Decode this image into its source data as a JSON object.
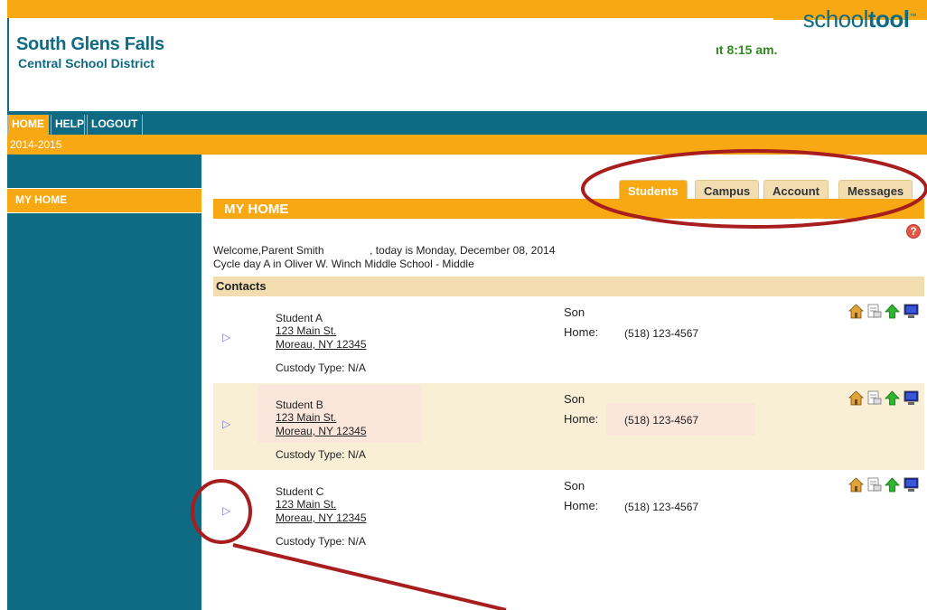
{
  "header": {
    "district_line1": "South Glens Falls",
    "district_line2": "Central School District",
    "clock_text": "ıt 8:15 am.",
    "logo_plain": "school",
    "logo_bold": "tool",
    "logo_tm": "™"
  },
  "nav": {
    "items": [
      "HOME",
      "HELP",
      "LOGOUT"
    ]
  },
  "year": "2014-2015",
  "sidebar": {
    "items": [
      "MY HOME"
    ]
  },
  "tabs": [
    {
      "label": "Students",
      "active": true
    },
    {
      "label": "Campus",
      "active": false
    },
    {
      "label": "Account",
      "active": false
    },
    {
      "label": "Messages",
      "active": false
    }
  ],
  "main": {
    "section_title": "MY HOME",
    "help_icon": "?",
    "welcome_prefix": "Welcome,",
    "welcome_name": "Parent Smith",
    "welcome_suffix": ", today is Monday, December 08, 2014",
    "cycle_text": "Cycle day A in Oliver W. Winch Middle School - Middle",
    "contacts_title": "Contacts"
  },
  "contacts": [
    {
      "arrow": "▷",
      "name": "Student A",
      "addr1": "123 Main St.",
      "addr2": "Moreau, NY 12345",
      "custody": "Custody Type: N/A",
      "relation": "Son",
      "home_label": "Home:",
      "phone": "(518) 123-4567"
    },
    {
      "arrow": "▷",
      "name": "Student B",
      "addr1": "123 Main St.",
      "addr2": "Moreau, NY 12345",
      "custody": "Custody Type: N/A",
      "relation": "Son",
      "home_label": "Home:",
      "phone": "(518) 123-4567"
    },
    {
      "arrow": "▷",
      "name": "Student C",
      "addr1": "123 Main St.",
      "addr2": "Moreau, NY 12345",
      "custody": "Custody Type: N/A",
      "relation": "Son",
      "home_label": "Home:",
      "phone": "(518) 123-4567"
    }
  ],
  "row_icons": [
    "house-icon",
    "document-icon",
    "up-arrow-icon",
    "computer-icon"
  ],
  "colors": {
    "brand_teal": "#0f6a84",
    "brand_orange": "#f7a813",
    "annotation_red": "#a81d1d"
  }
}
